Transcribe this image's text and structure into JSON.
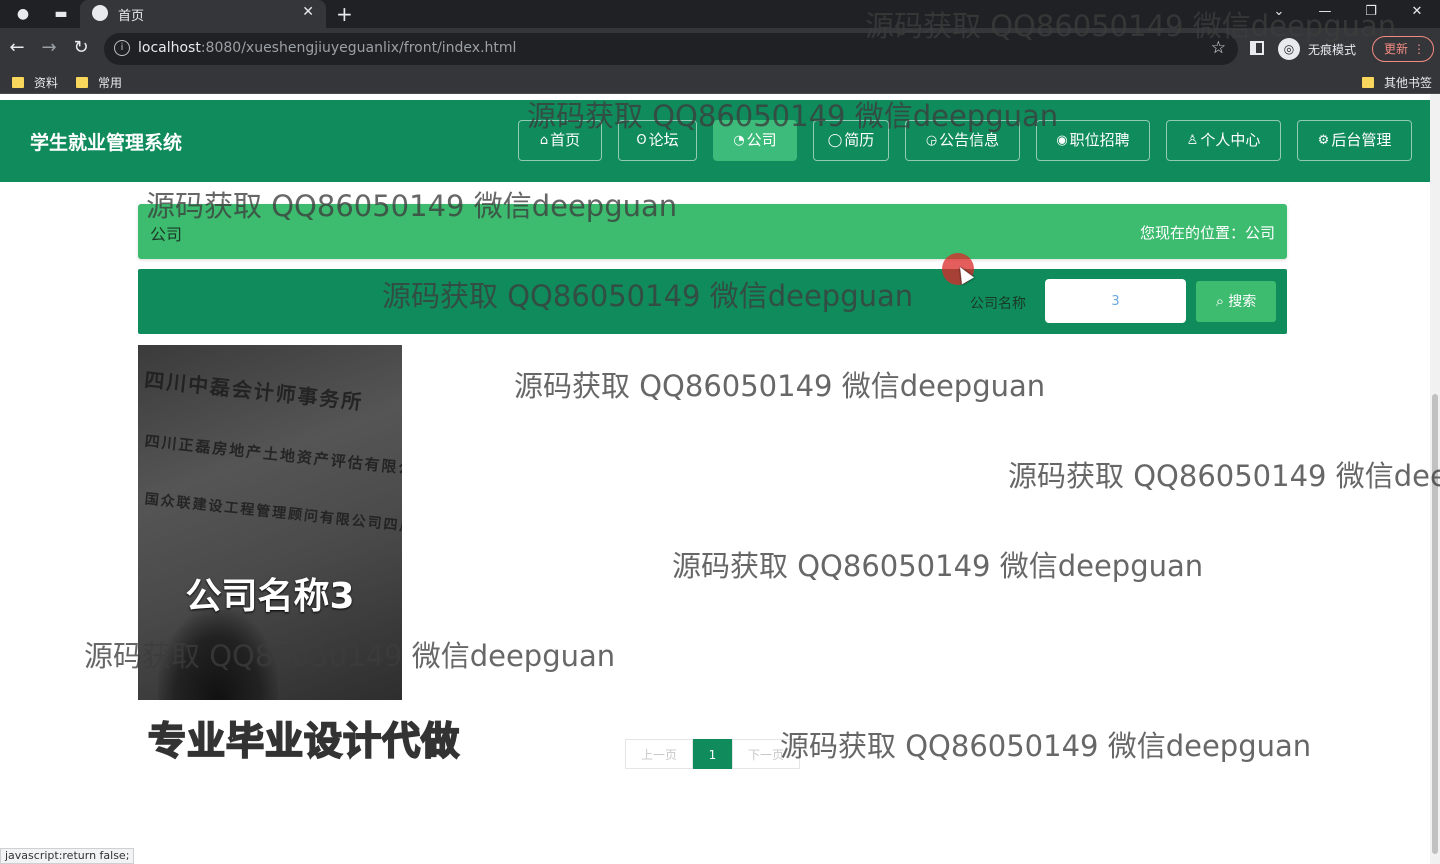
{
  "browser": {
    "tab_title": "首页",
    "url_host": "localhost",
    "url_rest": ":8080/xueshengjiuyeguanlix/front/index.html",
    "incognito_label": "无痕模式",
    "update_label": "更新",
    "bookmarks": [
      "资料",
      "常用"
    ],
    "other_bookmarks": "其他书签",
    "status_text": "javascript:return false;"
  },
  "site": {
    "title": "学生就业管理系统",
    "nav": [
      {
        "label": "首页",
        "icon": "⌂"
      },
      {
        "label": "论坛",
        "icon": "ʘ"
      },
      {
        "label": "公司",
        "icon": "◔"
      },
      {
        "label": "简历",
        "icon": "◯"
      },
      {
        "label": "公告信息",
        "icon": "◶"
      },
      {
        "label": "职位招聘",
        "icon": "◉"
      },
      {
        "label": "个人中心",
        "icon": "♙"
      },
      {
        "label": "后台管理",
        "icon": "⚙"
      }
    ],
    "active_nav": "公司"
  },
  "breadcrumb": {
    "title": "公司",
    "location": "您现在的位置：公司"
  },
  "search": {
    "label": "公司名称",
    "value": "3",
    "button": "搜索"
  },
  "company": {
    "name": "公司名称3",
    "wall_lines": [
      "四川中磊会计师事务所",
      "四川正磊房地产土地资产评估有限公司",
      "国众联建设工程管理顾问有限公司四川分公司"
    ]
  },
  "promo": "专业毕业设计代做",
  "pagination": {
    "prev": "上一页",
    "current": "1",
    "next": "下一页"
  },
  "watermark_text": "源码获取 QQ86050149 微信deepguan",
  "colors": {
    "header_green": "#0f8b5c",
    "accent_green": "#3dbb6f"
  }
}
